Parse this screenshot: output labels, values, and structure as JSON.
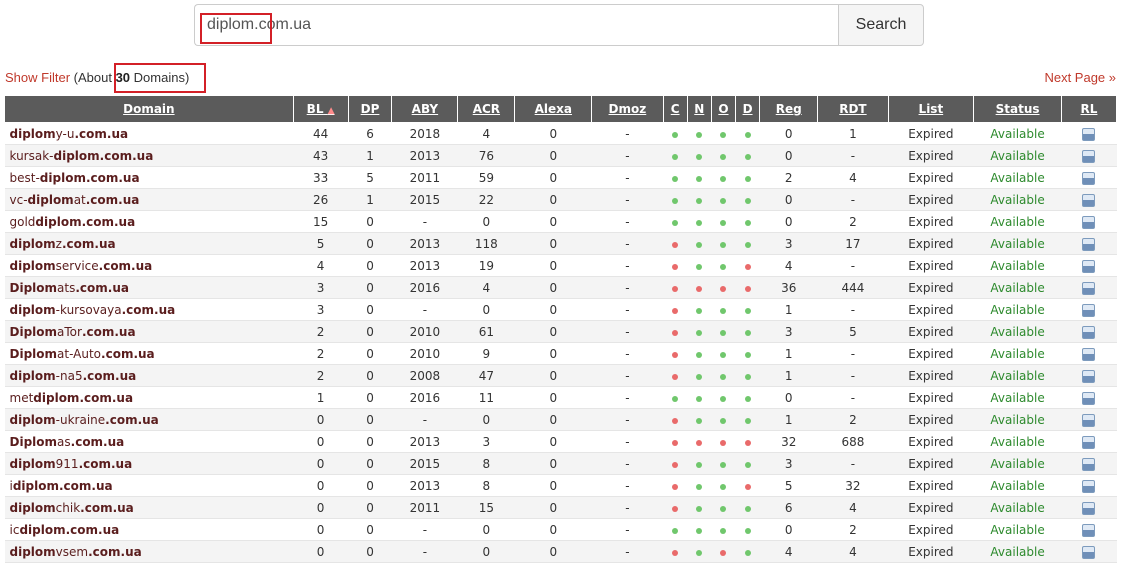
{
  "search": {
    "value_highlight": "diplom",
    "value_rest": ".com.ua",
    "button_label": "Search"
  },
  "filter": {
    "show_filter": "Show Filter",
    "count_prefix": " (About ",
    "count": "30",
    "count_suffix": " Domains)"
  },
  "next_page": "Next Page »",
  "columns": [
    "Domain",
    "BL",
    "DP",
    "ABY",
    "ACR",
    "Alexa",
    "Dmoz",
    "C",
    "N",
    "O",
    "D",
    "Reg",
    "RDT",
    "List",
    "Status",
    "RL"
  ],
  "sort_indicator": "▲",
  "rows": [
    {
      "pre": "",
      "bold": "diplom",
      "mid": "y-u",
      "tld": ".com.ua",
      "bl": "44",
      "dp": "6",
      "aby": "2018",
      "acr": "4",
      "alexa": "0",
      "dmoz": "-",
      "c": "g",
      "n": "g",
      "o": "g",
      "d": "g",
      "reg": "0",
      "rdt": "1",
      "list": "Expired",
      "status": "Available"
    },
    {
      "pre": "kursak-",
      "bold": "diplom",
      "mid": "",
      "tld": ".com.ua",
      "bl": "43",
      "dp": "1",
      "aby": "2013",
      "acr": "76",
      "alexa": "0",
      "dmoz": "-",
      "c": "g",
      "n": "g",
      "o": "g",
      "d": "g",
      "reg": "0",
      "rdt": "-",
      "list": "Expired",
      "status": "Available"
    },
    {
      "pre": "best-",
      "bold": "diplom",
      "mid": "",
      "tld": ".com.ua",
      "bl": "33",
      "dp": "5",
      "aby": "2011",
      "acr": "59",
      "alexa": "0",
      "dmoz": "-",
      "c": "g",
      "n": "g",
      "o": "g",
      "d": "g",
      "reg": "2",
      "rdt": "4",
      "list": "Expired",
      "status": "Available"
    },
    {
      "pre": "vc-",
      "bold": "diplom",
      "mid": "at",
      "tld": ".com.ua",
      "bl": "26",
      "dp": "1",
      "aby": "2015",
      "acr": "22",
      "alexa": "0",
      "dmoz": "-",
      "c": "g",
      "n": "g",
      "o": "g",
      "d": "g",
      "reg": "0",
      "rdt": "-",
      "list": "Expired",
      "status": "Available"
    },
    {
      "pre": "gold",
      "bold": "diplom",
      "mid": "",
      "tld": ".com.ua",
      "bl": "15",
      "dp": "0",
      "aby": "-",
      "acr": "0",
      "alexa": "0",
      "dmoz": "-",
      "c": "g",
      "n": "g",
      "o": "g",
      "d": "g",
      "reg": "0",
      "rdt": "2",
      "list": "Expired",
      "status": "Available"
    },
    {
      "pre": "",
      "bold": "diplom",
      "mid": "z",
      "tld": ".com.ua",
      "bl": "5",
      "dp": "0",
      "aby": "2013",
      "acr": "118",
      "alexa": "0",
      "dmoz": "-",
      "c": "r",
      "n": "g",
      "o": "g",
      "d": "g",
      "reg": "3",
      "rdt": "17",
      "list": "Expired",
      "status": "Available"
    },
    {
      "pre": "",
      "bold": "diplom",
      "mid": "service",
      "tld": ".com.ua",
      "bl": "4",
      "dp": "0",
      "aby": "2013",
      "acr": "19",
      "alexa": "0",
      "dmoz": "-",
      "c": "r",
      "n": "g",
      "o": "g",
      "d": "r",
      "reg": "4",
      "rdt": "-",
      "list": "Expired",
      "status": "Available"
    },
    {
      "pre": "",
      "bold": "Diplom",
      "mid": "ats",
      "tld": ".com.ua",
      "bl": "3",
      "dp": "0",
      "aby": "2016",
      "acr": "4",
      "alexa": "0",
      "dmoz": "-",
      "c": "r",
      "n": "r",
      "o": "r",
      "d": "r",
      "reg": "36",
      "rdt": "444",
      "list": "Expired",
      "status": "Available"
    },
    {
      "pre": "",
      "bold": "diplom",
      "mid": "-kursovaya",
      "tld": ".com.ua",
      "bl": "3",
      "dp": "0",
      "aby": "-",
      "acr": "0",
      "alexa": "0",
      "dmoz": "-",
      "c": "r",
      "n": "g",
      "o": "g",
      "d": "g",
      "reg": "1",
      "rdt": "-",
      "list": "Expired",
      "status": "Available"
    },
    {
      "pre": "",
      "bold": "Diplom",
      "mid": "aTor",
      "tld": ".com.ua",
      "bl": "2",
      "dp": "0",
      "aby": "2010",
      "acr": "61",
      "alexa": "0",
      "dmoz": "-",
      "c": "r",
      "n": "g",
      "o": "g",
      "d": "g",
      "reg": "3",
      "rdt": "5",
      "list": "Expired",
      "status": "Available"
    },
    {
      "pre": "",
      "bold": "Diplom",
      "mid": "at-Auto",
      "tld": ".com.ua",
      "bl": "2",
      "dp": "0",
      "aby": "2010",
      "acr": "9",
      "alexa": "0",
      "dmoz": "-",
      "c": "r",
      "n": "g",
      "o": "g",
      "d": "g",
      "reg": "1",
      "rdt": "-",
      "list": "Expired",
      "status": "Available"
    },
    {
      "pre": "",
      "bold": "diplom",
      "mid": "-na5",
      "tld": ".com.ua",
      "bl": "2",
      "dp": "0",
      "aby": "2008",
      "acr": "47",
      "alexa": "0",
      "dmoz": "-",
      "c": "r",
      "n": "g",
      "o": "g",
      "d": "g",
      "reg": "1",
      "rdt": "-",
      "list": "Expired",
      "status": "Available"
    },
    {
      "pre": "met",
      "bold": "diplom",
      "mid": "",
      "tld": ".com.ua",
      "bl": "1",
      "dp": "0",
      "aby": "2016",
      "acr": "11",
      "alexa": "0",
      "dmoz": "-",
      "c": "g",
      "n": "g",
      "o": "g",
      "d": "g",
      "reg": "0",
      "rdt": "-",
      "list": "Expired",
      "status": "Available"
    },
    {
      "pre": "",
      "bold": "diplom",
      "mid": "-ukraine",
      "tld": ".com.ua",
      "bl": "0",
      "dp": "0",
      "aby": "-",
      "acr": "0",
      "alexa": "0",
      "dmoz": "-",
      "c": "r",
      "n": "g",
      "o": "g",
      "d": "g",
      "reg": "1",
      "rdt": "2",
      "list": "Expired",
      "status": "Available"
    },
    {
      "pre": "",
      "bold": "Diplom",
      "mid": "as",
      "tld": ".com.ua",
      "bl": "0",
      "dp": "0",
      "aby": "2013",
      "acr": "3",
      "alexa": "0",
      "dmoz": "-",
      "c": "r",
      "n": "r",
      "o": "r",
      "d": "r",
      "reg": "32",
      "rdt": "688",
      "list": "Expired",
      "status": "Available"
    },
    {
      "pre": "",
      "bold": "diplom",
      "mid": "911",
      "tld": ".com.ua",
      "bl": "0",
      "dp": "0",
      "aby": "2015",
      "acr": "8",
      "alexa": "0",
      "dmoz": "-",
      "c": "r",
      "n": "g",
      "o": "g",
      "d": "g",
      "reg": "3",
      "rdt": "-",
      "list": "Expired",
      "status": "Available"
    },
    {
      "pre": "i",
      "bold": "diplom",
      "mid": "",
      "tld": ".com.ua",
      "bl": "0",
      "dp": "0",
      "aby": "2013",
      "acr": "8",
      "alexa": "0",
      "dmoz": "-",
      "c": "r",
      "n": "g",
      "o": "g",
      "d": "r",
      "reg": "5",
      "rdt": "32",
      "list": "Expired",
      "status": "Available"
    },
    {
      "pre": "",
      "bold": "diplom",
      "mid": "chik",
      "tld": ".com.ua",
      "bl": "0",
      "dp": "0",
      "aby": "2011",
      "acr": "15",
      "alexa": "0",
      "dmoz": "-",
      "c": "r",
      "n": "g",
      "o": "g",
      "d": "g",
      "reg": "6",
      "rdt": "4",
      "list": "Expired",
      "status": "Available"
    },
    {
      "pre": "ic",
      "bold": "diplom",
      "mid": "",
      "tld": ".com.ua",
      "bl": "0",
      "dp": "0",
      "aby": "-",
      "acr": "0",
      "alexa": "0",
      "dmoz": "-",
      "c": "g",
      "n": "g",
      "o": "g",
      "d": "g",
      "reg": "0",
      "rdt": "2",
      "list": "Expired",
      "status": "Available"
    },
    {
      "pre": "",
      "bold": "diplom",
      "mid": "vsem",
      "tld": ".com.ua",
      "bl": "0",
      "dp": "0",
      "aby": "-",
      "acr": "0",
      "alexa": "0",
      "dmoz": "-",
      "c": "r",
      "n": "g",
      "o": "r",
      "d": "g",
      "reg": "4",
      "rdt": "4",
      "list": "Expired",
      "status": "Available"
    }
  ],
  "colors": {
    "header_bg": "#5b5b5b",
    "link_red": "#c0392b",
    "available_green": "#2d8a2d",
    "dot_green": "#70c76c",
    "dot_red": "#e96a6a",
    "highlight_box": "#d32027"
  },
  "icons": {
    "rl": "save-disk-icon"
  }
}
